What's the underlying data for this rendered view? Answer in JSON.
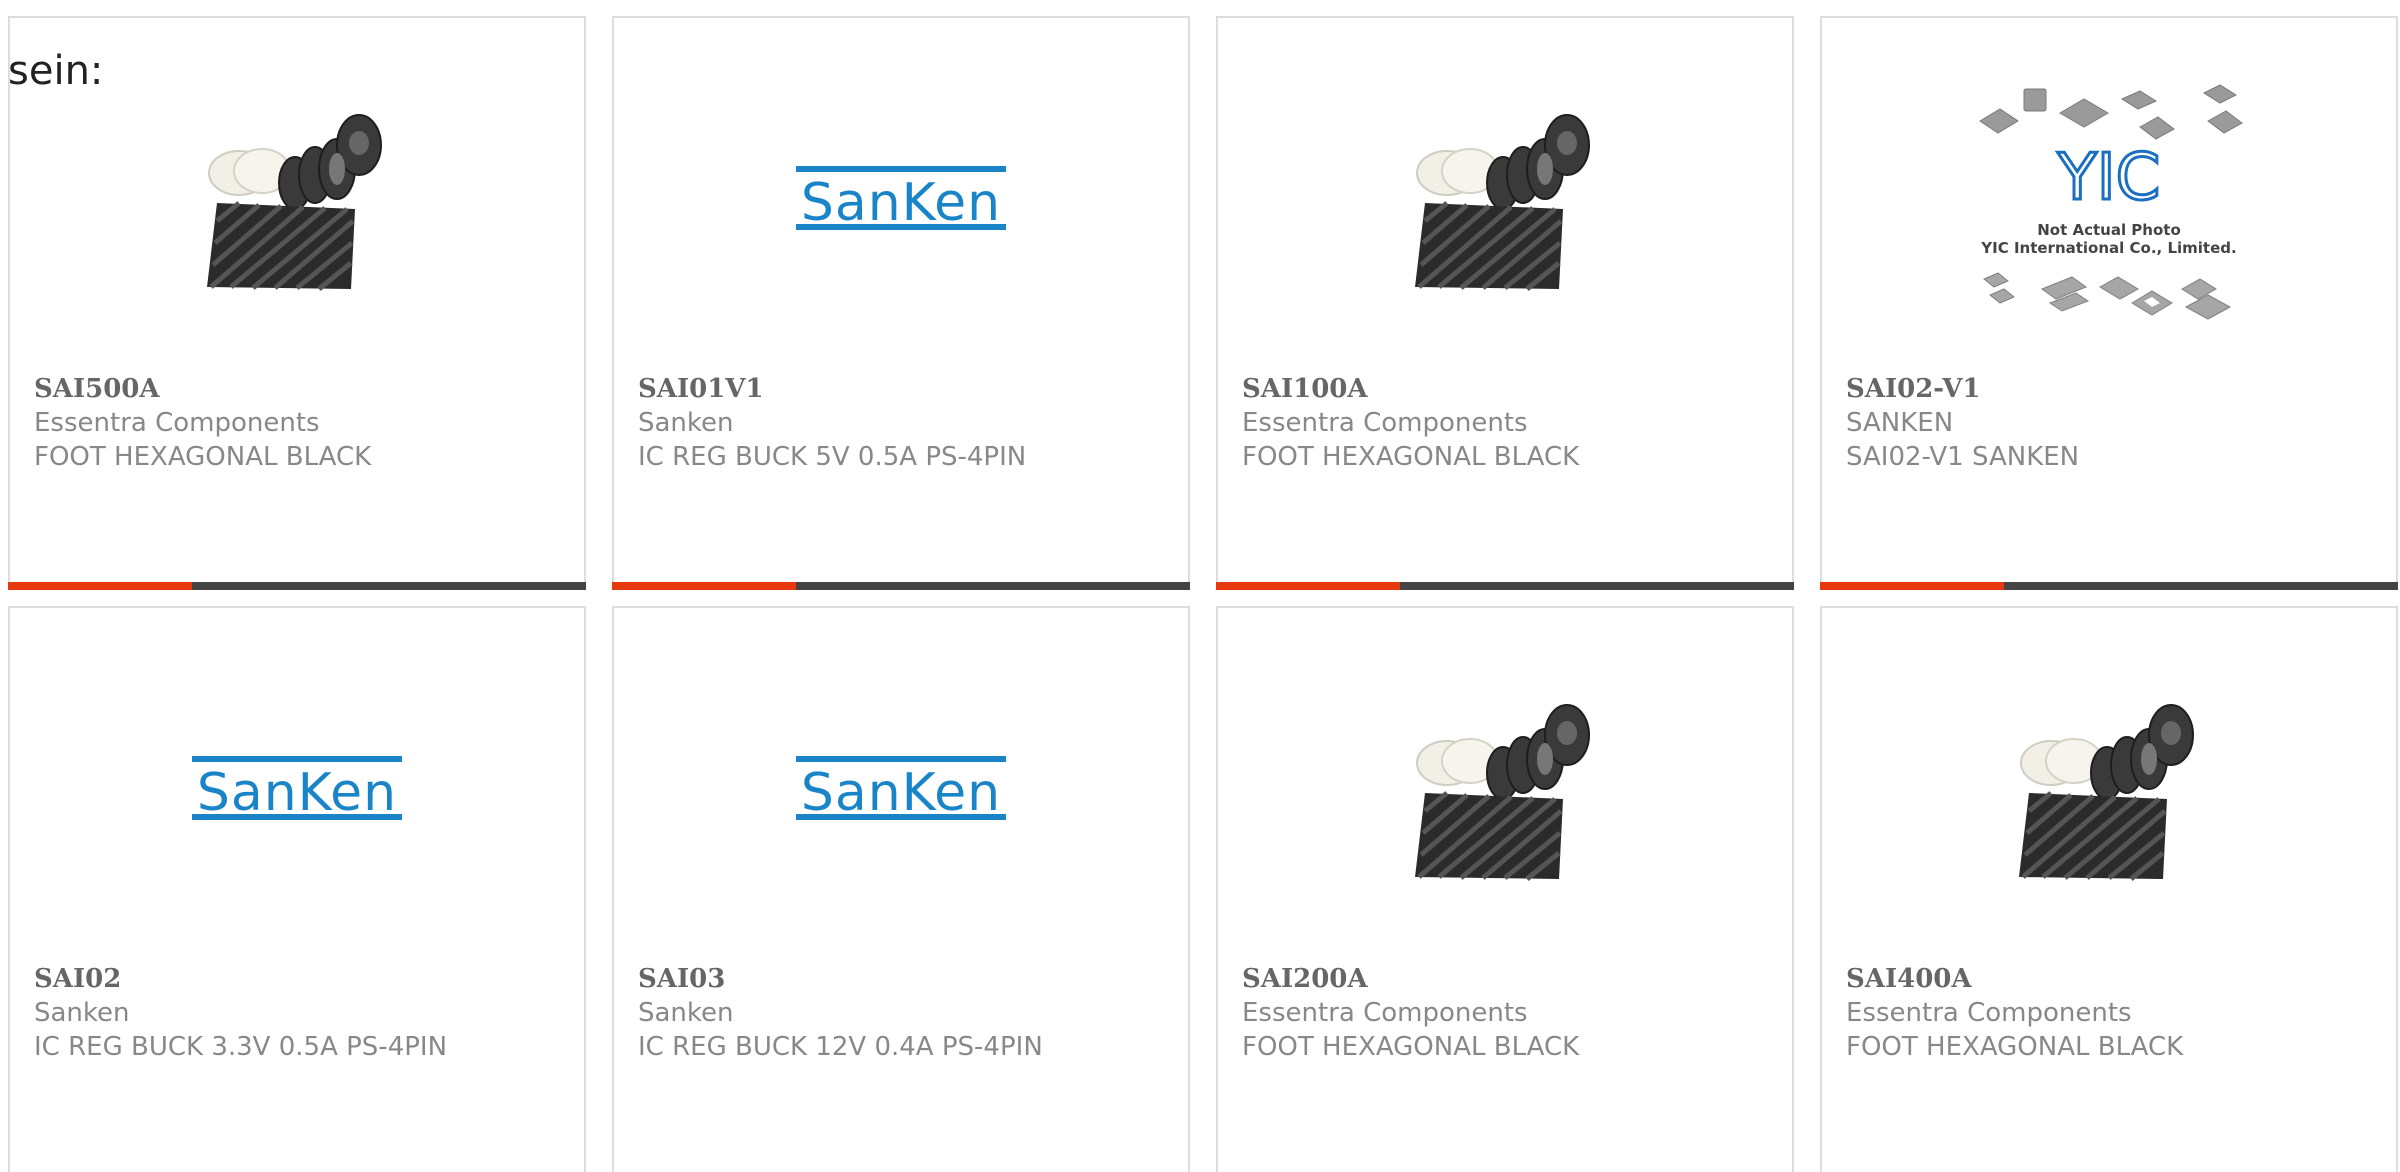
{
  "intro": {
    "text": "sein:"
  },
  "colors": {
    "accent": "#e8380d",
    "bar": "#444444",
    "sanken_blue": "#1a84c8"
  },
  "products": [
    {
      "part_number": "SAI500A",
      "manufacturer": "Essentra Components",
      "description": "FOOT HEXAGONAL BLACK",
      "image": "foot-hexagonal-photo"
    },
    {
      "part_number": "SAI01V1",
      "manufacturer": "Sanken",
      "description": "IC REG BUCK 5V 0.5A PS-4PIN",
      "image": "sanken-logo"
    },
    {
      "part_number": "SAI100A",
      "manufacturer": "Essentra Components",
      "description": "FOOT HEXAGONAL BLACK",
      "image": "foot-hexagonal-photo"
    },
    {
      "part_number": "SAI02-V1",
      "manufacturer": "SANKEN",
      "description": "SAI02-V1 SANKEN",
      "image": "yic-not-actual-photo"
    },
    {
      "part_number": "SAI02",
      "manufacturer": "Sanken",
      "description": "IC REG BUCK 3.3V 0.5A PS-4PIN",
      "image": "sanken-logo"
    },
    {
      "part_number": "SAI03",
      "manufacturer": "Sanken",
      "description": "IC REG BUCK 12V 0.4A PS-4PIN",
      "image": "sanken-logo"
    },
    {
      "part_number": "SAI200A",
      "manufacturer": "Essentra Components",
      "description": "FOOT HEXAGONAL BLACK",
      "image": "foot-hexagonal-photo"
    },
    {
      "part_number": "SAI400A",
      "manufacturer": "Essentra Components",
      "description": "FOOT HEXAGONAL BLACK",
      "image": "foot-hexagonal-photo"
    }
  ],
  "logos": {
    "sanken_text": "SanKen",
    "yic_mark": "YIC",
    "yic_line1": "Not Actual Photo",
    "yic_line2": "YIC International Co., Limited."
  }
}
